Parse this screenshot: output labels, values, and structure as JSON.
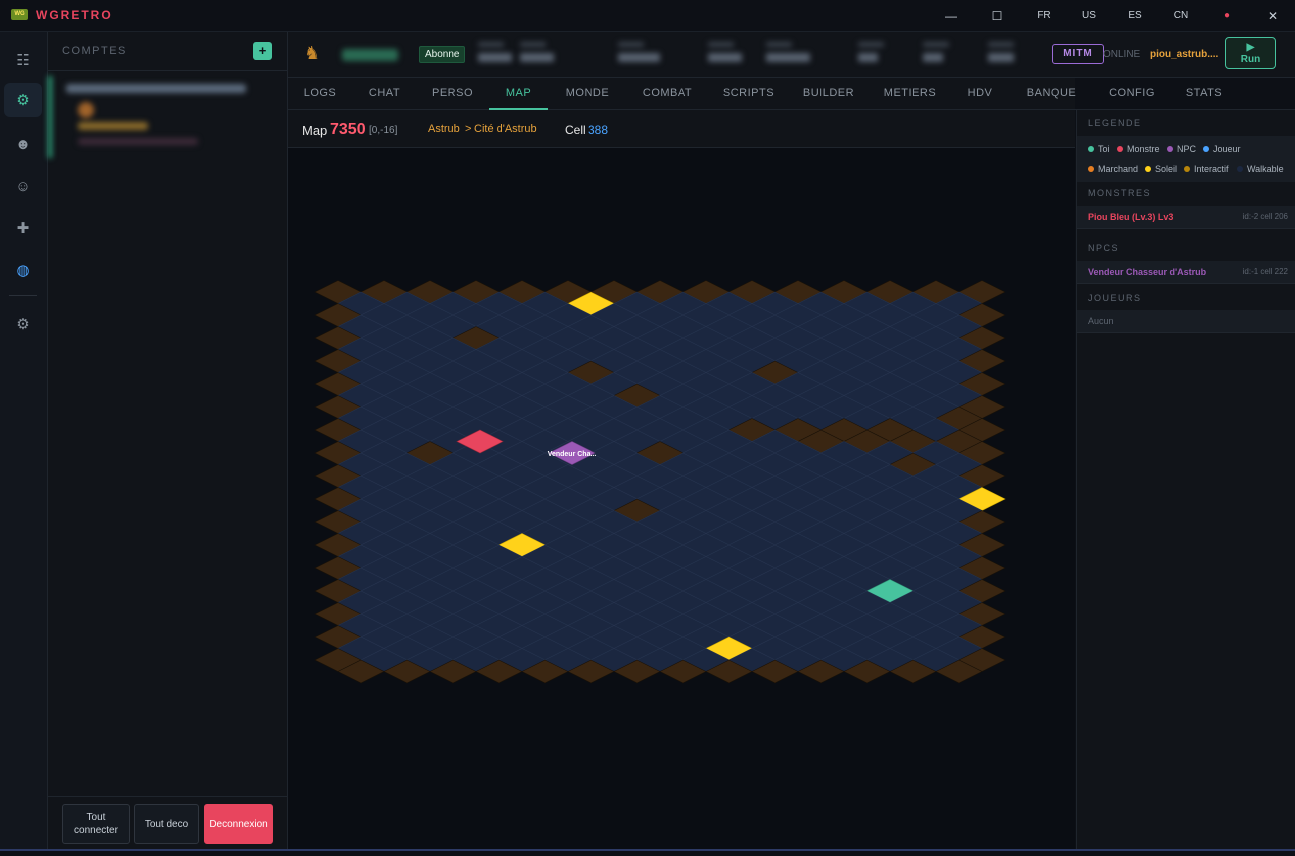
{
  "app": {
    "name": "WGRETRO",
    "logo_text": "WG"
  },
  "window": {
    "lang_fr": "FR",
    "lang_us": "US",
    "lang_es": "ES",
    "lang_cn": "CN",
    "minimize": "—",
    "maximize": "☐",
    "close": "✕",
    "eye": "●"
  },
  "rail": [
    {
      "icon": "☷",
      "name": "list-icon"
    },
    {
      "icon": "⚙",
      "name": "bot-icon"
    },
    {
      "icon": "☻",
      "name": "character-icon"
    },
    {
      "icon": "☺",
      "name": "group-icon"
    },
    {
      "icon": "✚",
      "name": "plus-icon"
    },
    {
      "icon": "◍",
      "name": "globe-icon"
    },
    {
      "icon": "⚙",
      "name": "settings-icon"
    }
  ],
  "accounts": {
    "title": "COMPTES",
    "add": "+",
    "connect_all": "Tout connecter",
    "disconnect_all": "Tout deco",
    "logout": "Deconnexion"
  },
  "header": {
    "badge": "Abonne",
    "mitm": "MITM",
    "status": "ONLINE",
    "username": "piou_astrub....",
    "run_icon": "▶",
    "run_label": "Run"
  },
  "tabs": [
    "LOGS",
    "CHAT",
    "PERSO",
    "MAP",
    "MONDE",
    "COMBAT",
    "SCRIPTS",
    "BUILDER",
    "METIERS",
    "HDV",
    "BANQUE",
    "CONFIG",
    "STATS"
  ],
  "active_tab": "MAP",
  "map": {
    "label": "Map",
    "id": "7350",
    "coords": "[0,-16]",
    "area": "Astrub",
    "sep": ">",
    "subarea": "Cité d'Astrub",
    "cell_label": "Cell",
    "cell": "388",
    "npc_label": "Vendeur Cha...",
    "player_label": "Toi"
  },
  "panel": {
    "legend_title": "LEGENDE",
    "legend": [
      {
        "label": "Toi",
        "color": "#47c39e"
      },
      {
        "label": "Monstre",
        "color": "#e8455e"
      },
      {
        "label": "NPC",
        "color": "#9b59b6"
      },
      {
        "label": "Joueur",
        "color": "#4aa3ff"
      },
      {
        "label": "Marchand",
        "color": "#e67e22"
      },
      {
        "label": "Soleil",
        "color": "#ffd21a"
      },
      {
        "label": "Interactif",
        "color": "#b8860b"
      },
      {
        "label": "Walkable",
        "color": "#1b2740"
      }
    ],
    "monsters_title": "MONSTRES",
    "monsters": [
      {
        "name": "Piou Bleu (Lv.3) Lv3",
        "meta": "id:-2 cell 206"
      }
    ],
    "npcs_title": "NPCS",
    "npcs": [
      {
        "name": "Vendeur Chasseur d'Astrub",
        "meta": "id:-1 cell 222"
      }
    ],
    "players_title": "JOUEURS",
    "players_empty": "Aucun"
  },
  "colors": {
    "accent": "#47c39e",
    "danger": "#e8455e",
    "walkable": "#1b2740",
    "obstacle": "#3a2612",
    "sun": "#ffd21a",
    "npc": "#9b59b6",
    "monster": "#e8455e",
    "map_id": "#ff5a6e",
    "area": "#e6a23c",
    "cell": "#4aa3ff"
  }
}
